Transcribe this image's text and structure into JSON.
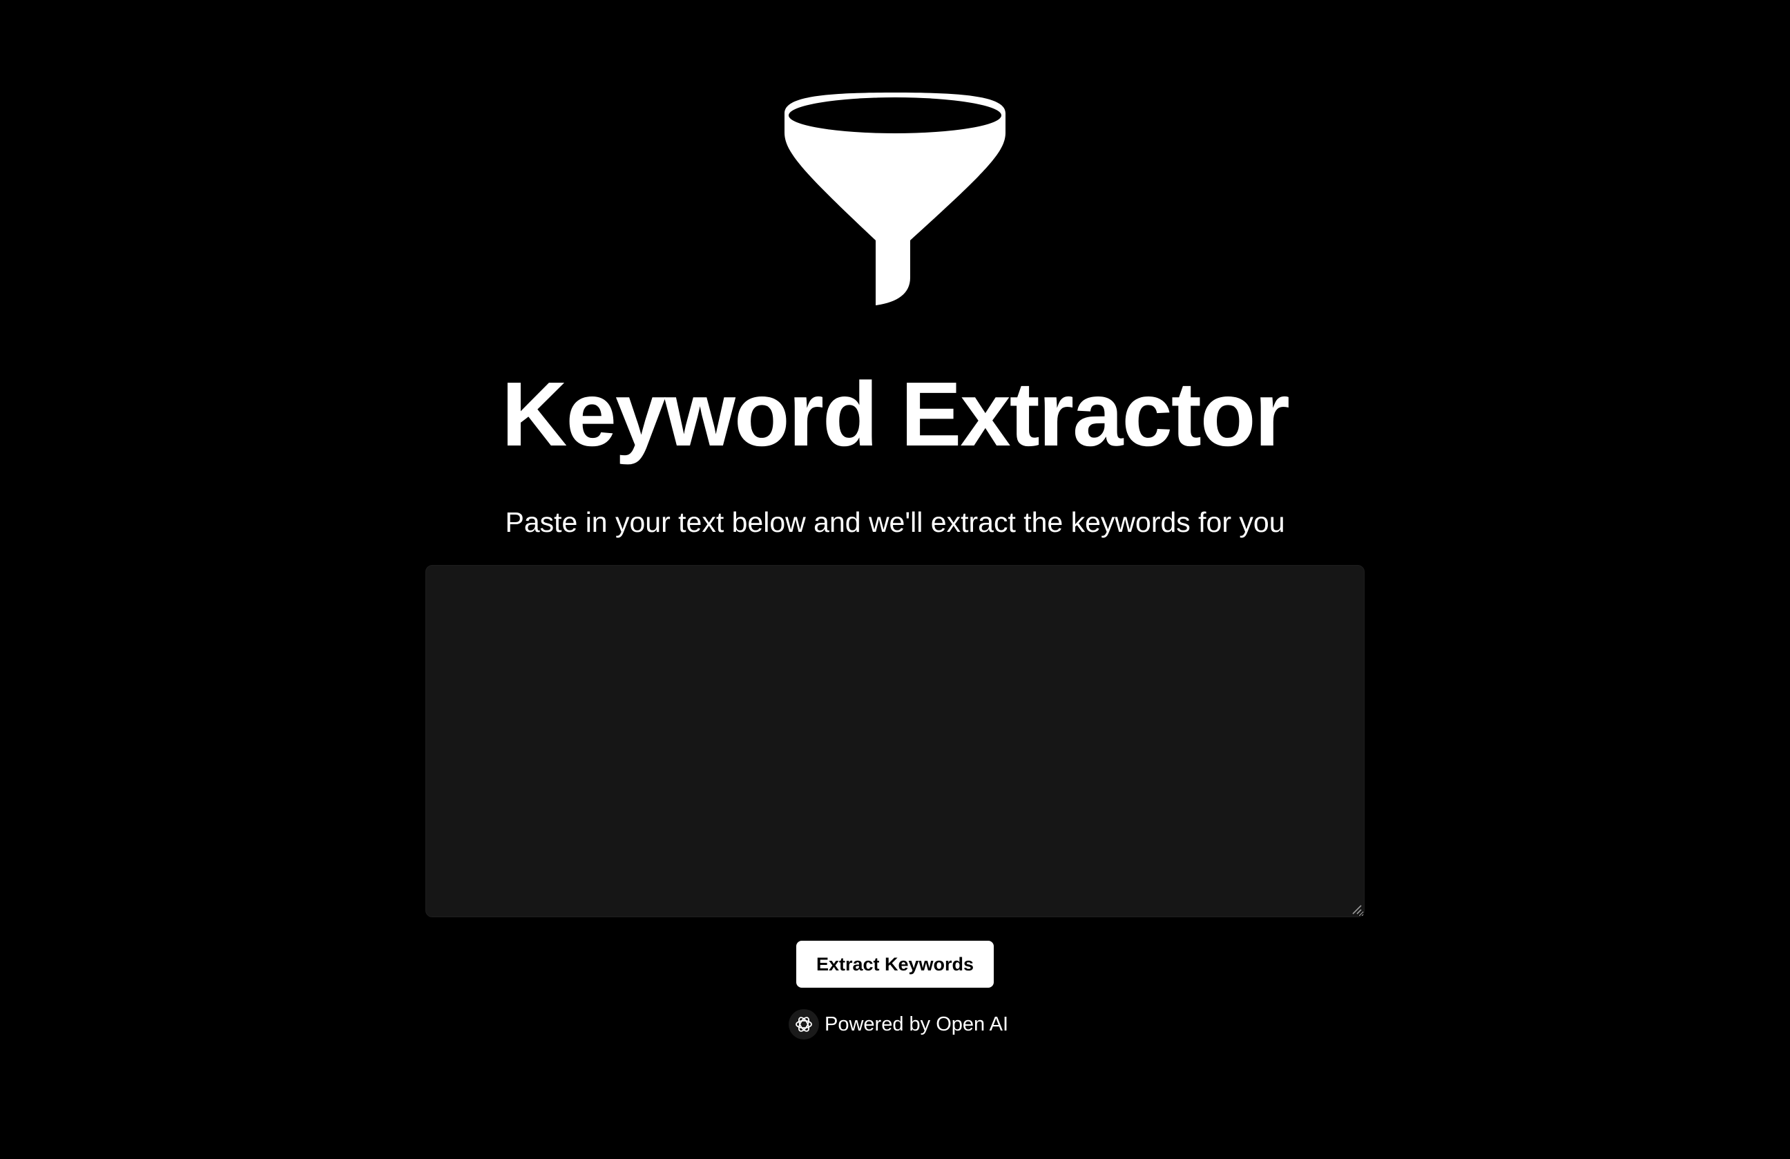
{
  "header": {
    "logo_icon": "funnel-icon",
    "title": "Keyword Extractor",
    "subtitle": "Paste in your text below and we'll extract the keywords for you"
  },
  "form": {
    "text_input": {
      "value": "",
      "placeholder": ""
    },
    "submit_label": "Extract Keywords"
  },
  "footer": {
    "icon": "openai-icon",
    "powered_by": "Powered by Open AI"
  },
  "colors": {
    "background": "#000000",
    "text": "#ffffff",
    "input_background": "#161616",
    "button_background": "#ffffff",
    "button_text": "#000000"
  }
}
